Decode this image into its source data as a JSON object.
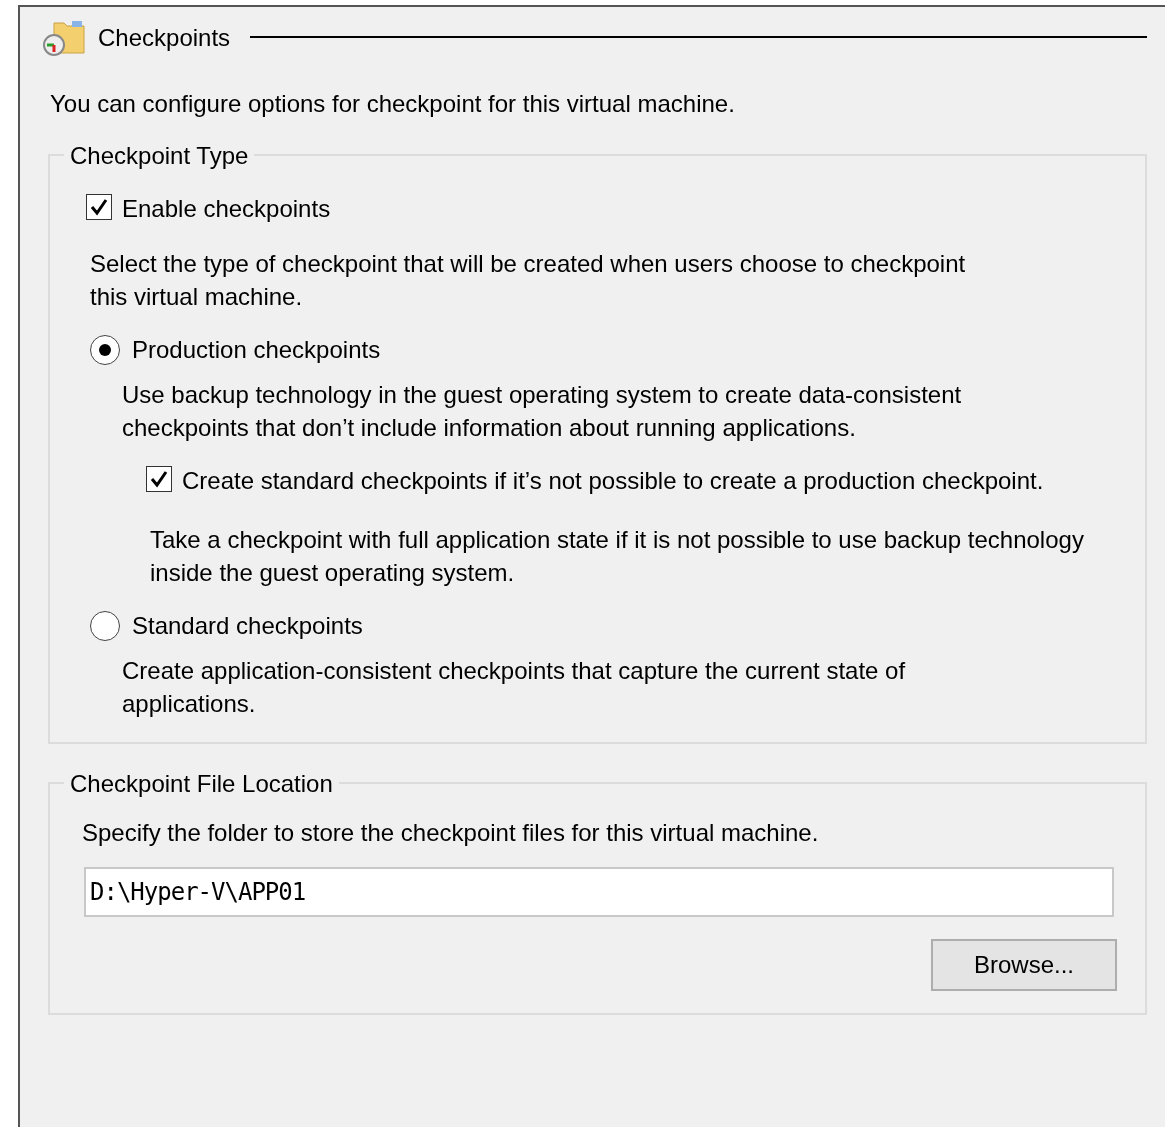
{
  "section": {
    "title": "Checkpoints"
  },
  "intro": "You can configure options for checkpoint for this virtual machine.",
  "checkpoint_type": {
    "legend": "Checkpoint Type",
    "enable_checkpoints": {
      "label": "Enable checkpoints",
      "checked": true
    },
    "instruction": "Select the type of checkpoint that will be created when users choose to checkpoint this virtual machine.",
    "options": [
      {
        "label": "Production checkpoints",
        "selected": true,
        "description": "Use backup technology in the guest operating system to create data-consistent checkpoints that don’t include information about running applications.",
        "fallback": {
          "label": "Create standard checkpoints if it’s not possible to create a production checkpoint.",
          "checked": true
        },
        "note": "Take a checkpoint with full application state if it is not possible to use backup technology inside the guest operating system."
      },
      {
        "label": "Standard checkpoints",
        "selected": false,
        "description": "Create application-consistent checkpoints that capture the current state of applications."
      }
    ]
  },
  "file_location": {
    "legend": "Checkpoint File Location",
    "instruction": "Specify the folder to store the checkpoint files for this virtual machine.",
    "path": {
      "value": "D:\\Hyper-V\\APP01"
    },
    "browse_button": "Browse..."
  }
}
